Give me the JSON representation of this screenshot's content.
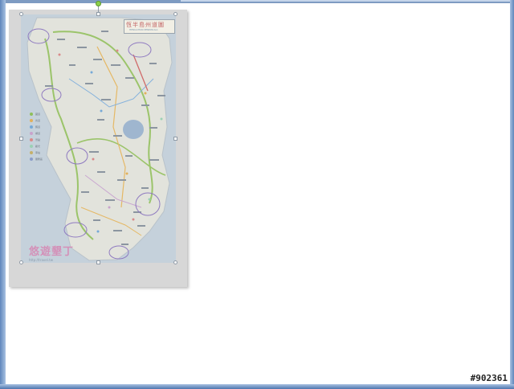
{
  "map": {
    "title": "恆半島州道圖",
    "subtitle": "HENGCHUN PENINSULA",
    "brand": "悠遊墾丁",
    "url": "http://travel.tw",
    "legend": [
      "國道",
      "省道",
      "縣道",
      "鄉道",
      "景點",
      "觀光",
      "車站",
      "服務區"
    ],
    "legend_colors": [
      "#8fbf5a",
      "#e2b05a",
      "#76a9d6",
      "#c9a3cc",
      "#d98a8a",
      "#9ad1b4",
      "#c5b06a",
      "#8b9dc9"
    ]
  },
  "watermark": "#902361"
}
